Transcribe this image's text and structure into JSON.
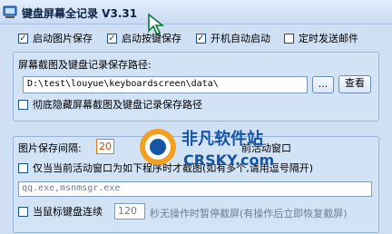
{
  "window": {
    "title": "键盘屏幕全记录 V3.31"
  },
  "options_row": [
    {
      "label": "启动图片保存",
      "checked": true
    },
    {
      "label": "启动按键保存",
      "checked": true
    },
    {
      "label": "开机自动启动",
      "checked": true
    },
    {
      "label": "定时发送邮件",
      "checked": false
    }
  ],
  "save_path": {
    "label": "屏幕截图及键盘记录保存路径:",
    "value": "D:\\test\\louyue\\keyboardscreen\\data\\",
    "browse_label": "...",
    "view_label": "查看",
    "hide_dir_label": "彻底隐藏屏幕截图及键盘记录保存路径",
    "hide_dir_checked": false
  },
  "capture": {
    "interval_label": "图片保存间隔:",
    "interval_value": "20",
    "active_window_label": "前活动窗口",
    "program_filter_label": "仅当当前活动窗口为如下程序时才截图(如有多个,请用逗号隔开)",
    "program_filter_checked": false,
    "program_list": "qq.exe,msnmsgr.exe",
    "idle_label": "当鼠标键盘连续",
    "idle_checked": false,
    "idle_value": "120",
    "idle_suffix": "秒无操作时暂停截屏(有操作后立即恢复截屏)"
  },
  "watermark": {
    "line1": "非凡软件站",
    "line2": "CRSKY.com"
  },
  "colors": {
    "accent": "#1b5fa8",
    "watermark_orange": "#f08a00",
    "watermark_blue": "#1455a4"
  }
}
